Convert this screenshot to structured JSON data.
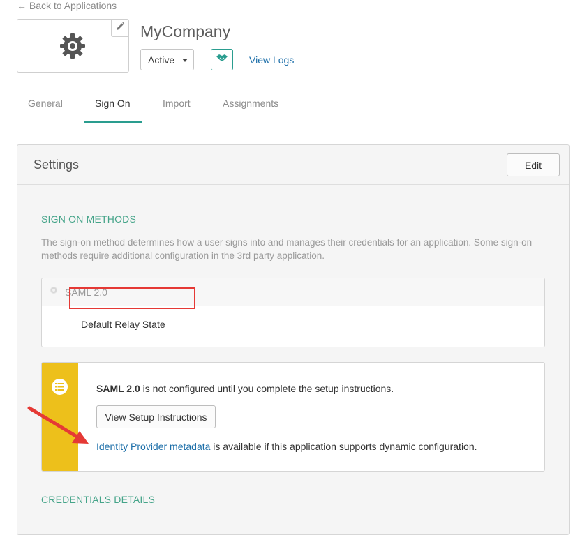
{
  "nav": {
    "back_label": "← Back to Applications"
  },
  "app": {
    "name": "MyCompany",
    "status": "Active",
    "view_logs_label": "View Logs",
    "accent_color": "#2a9d8f"
  },
  "tabs": [
    {
      "label": "General",
      "active": false
    },
    {
      "label": "Sign On",
      "active": true
    },
    {
      "label": "Import",
      "active": false
    },
    {
      "label": "Assignments",
      "active": false
    }
  ],
  "settings": {
    "title": "Settings",
    "edit_label": "Edit",
    "sign_on_heading": "SIGN ON METHODS",
    "description": "The sign-on method determines how a user signs into and manages their credentials for an application. Some sign-on methods require additional configuration in the 3rd party application.",
    "method": {
      "label": "SAML 2.0",
      "relay_state_label": "Default Relay State"
    },
    "notice": {
      "method_name": "SAML 2.0",
      "text_suffix": " is not configured until you complete the setup instructions.",
      "setup_button_label": "View Setup Instructions",
      "metadata_link_label": "Identity Provider metadata",
      "metadata_suffix": " is available if this application supports dynamic configuration."
    },
    "credentials_heading": "CREDENTIALS DETAILS"
  },
  "annotation": {
    "highlight_color": "#e53935"
  }
}
